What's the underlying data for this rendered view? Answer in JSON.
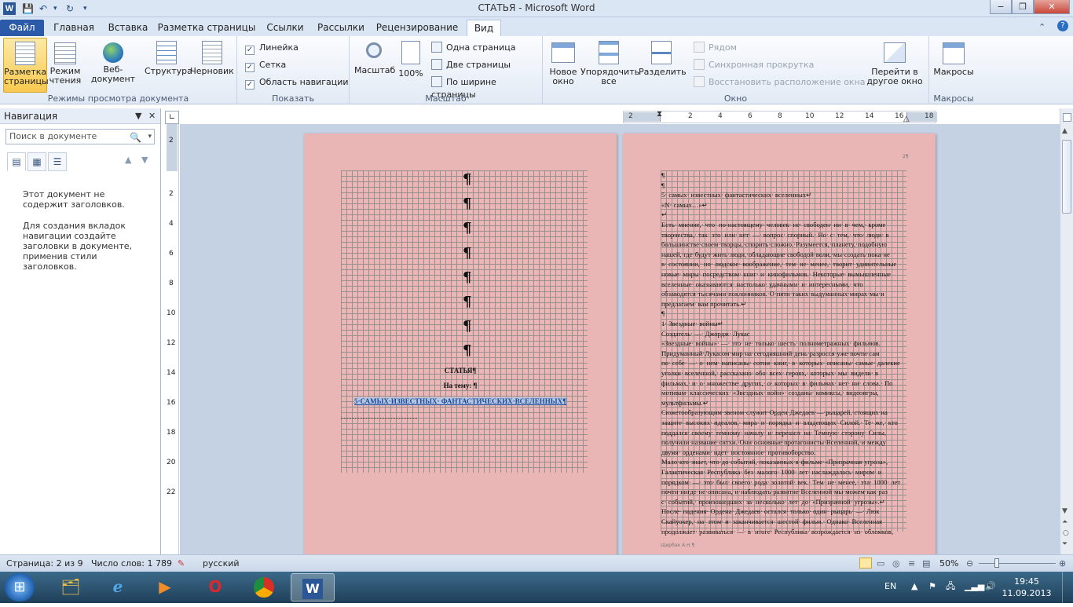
{
  "window": {
    "title": "СТАТЬЯ - Microsoft Word",
    "app_icon": "W",
    "controls": [
      "−",
      "❐",
      "✕"
    ]
  },
  "quick_access": [
    "save-icon",
    "undo-icon",
    "redo-icon",
    "customize-icon"
  ],
  "tabs": [
    "Файл",
    "Главная",
    "Вставка",
    "Разметка страницы",
    "Ссылки",
    "Рассылки",
    "Рецензирование",
    "Вид"
  ],
  "active_tab": "Вид",
  "ribbon": {
    "views": {
      "label": "Режимы просмотра документа",
      "buttons": [
        {
          "label": "Разметка страницы",
          "selected": true
        },
        {
          "label": "Режим чтения"
        },
        {
          "label": "Веб-документ"
        },
        {
          "label": "Структура"
        },
        {
          "label": "Черновик"
        }
      ]
    },
    "show": {
      "label": "Показать",
      "items": [
        {
          "label": "Линейка",
          "checked": true
        },
        {
          "label": "Сетка",
          "checked": true
        },
        {
          "label": "Область навигации",
          "checked": true
        }
      ]
    },
    "zoom": {
      "label": "Масштаб",
      "zoom_btn": "Масштаб",
      "pct_btn": "100%",
      "small": [
        "Одна страница",
        "Две страницы",
        "По ширине страницы"
      ]
    },
    "window": {
      "label": "Окно",
      "new_window": "Новое окно",
      "arrange_all": "Упорядочить все",
      "split": "Разделить",
      "small": [
        "Рядом",
        "Синхронная прокрутка",
        "Восстановить расположение окна"
      ],
      "switch": "Перейти в другое окно"
    },
    "macros": {
      "label": "Макросы",
      "btn": "Макросы"
    }
  },
  "navigation": {
    "title": "Навигация",
    "search_placeholder": "Поиск в документе",
    "message1": "Этот документ не содержит заголовков.",
    "message2": "Для создания вкладок навигации создайте заголовки в документе, применив стили заголовков."
  },
  "ruler": {
    "h_ticks": [
      "2",
      "2",
      "4",
      "6",
      "8",
      "10",
      "12",
      "14",
      "16",
      "18"
    ],
    "v_ticks": [
      "2",
      "2",
      "4",
      "6",
      "8",
      "10",
      "12",
      "14",
      "16",
      "18",
      "20",
      "22"
    ]
  },
  "page1": {
    "pilcrow": "¶",
    "title": "СТАТЬЯ¶",
    "subtitle": "На тему: ¶",
    "heading": "5·САМЫХ·ИЗВЕСТНЫХ· ФАНТАСТИЧЕСКИХ·ВСЕЛЕННЫХ¶"
  },
  "page2": {
    "page_num": "2¶",
    "footer": "Щербак А.Н.¶",
    "lines": [
      "¶",
      "¶",
      "5·         самых·         известных·         фантастических·         вселенных↵",
      "«N·                                                                           самых…»↵",
      "↵",
      "Есть· мнение,· что· по-настоящему· человек· не· свободен· ни· в· чем,· кроме",
      "творчества,· так· это· или· нет· —· вопрос· спорный.· Но· с· тем,· что· люди· в",
      "большинстве·своем·творцы,·спорить·сложно.·Разумеется,·планету,·подобную",
      "нашей,·где·будут·жить·люди,·обладающие·свободой·воли,·мы·создать·пока·не",
      "в· состоянии,· но· людское· воображение,· тем· не· менее,· творит· удивительные",
      "новые· миры· посредством· книг· и· кинофильмов.· Некоторые· вымышленные",
      "вселенные·  оказываются·  настолько·  удачными·  и·  интересными,·  что",
      "обзаводятся·тысячами·поклонников.·О·пяти·таких·выдуманных·мирах·мы·и",
      "предлагаем·                         вам                         прочитать.↵",
      "¶",
      "1·                          Звездные·                                  войны↵",
      "Создатель·           —·           Джордж·           Лукас",
      "«Звездные· войны»· —· это· не· только· шесть· полнометражных· фильмов.",
      "Придуманный·Лукасом·мир·на·сегодняшний·день·разросся·уже·почти·сам",
      "по· себе· —· о· нем· написаны· сотни· книг,· в· которых· описаны· самые· далекие",
      "уголки· вселенной,· рассказано· обо· всех· героях,· которых· мы· видели· в",
      "фильмах,· и· о· множестве· других,· о· которых· в· фильмах· нет· ни· слова.· По",
      "мотивам·  классических·  «Звездных·  войн»·  созданы·  комиксы,·  видеоигры,",
      "мультфильмы.↵",
      "Сюжетообразующим·звеном·служит·Орден·Джедаев·—·рыцарей,·стоящих·на",
      "защите· высоких· идеалов,· мира· и· порядка· и· владеющих· Силой.· Те· же,· кто",
      "поддался· своему· темному· началу· и· перешел· на· Темную· сторону· Силы,",
      "получили·название·ситхи.·Они·основные·протагонисты·Вселенной,·и·между",
      "двумя·         орденами·         идет·         постоянное·         противоборство.",
      "Мало·кто·знает,·что·до·событий,·показанных·в·фильме·«Призрачная·угроза»,",
      "Галактическая·  Республика·  без·  малого·  1000·  лет·  наслаждалась·  миром·  и",
      "порядком· —· это· был· своего· рода· золотой· век.· Тем· не· менее,· эта· 1000· лет",
      "почти·нигде·не·описана,·и·наблюдать·развитие·Вселенной·мы·можем·как·раз",
      "с· событий,· произошедших· за· несколько· лет· до· «Призрачной· угрозы».↵",
      "После· падения· Ордена· Джедаев· остался· только· один· рыцарь· —· Люк",
      "Скайуокер,· на· этом· и· заканчивается· шестой· фильм.· Однако· Вселенная",
      "продолжает· развиваться· —· в· итоге· Республика· возрождается· из· обломков,"
    ]
  },
  "status": {
    "page": "Страница: 2 из 9",
    "words": "Число слов: 1 789",
    "lang": "русский",
    "zoom": "50%"
  },
  "taskbar": {
    "apps": [
      "windows-explorer",
      "internet-explorer",
      "media-player",
      "opera",
      "chrome",
      "word"
    ],
    "lang": "EN",
    "time": "19:45",
    "date": "11.09.2013"
  },
  "colors": {
    "page_bg": "#e9b5b5",
    "file_tab": "#2a5aa8",
    "workspace": "#c5d2e3"
  }
}
